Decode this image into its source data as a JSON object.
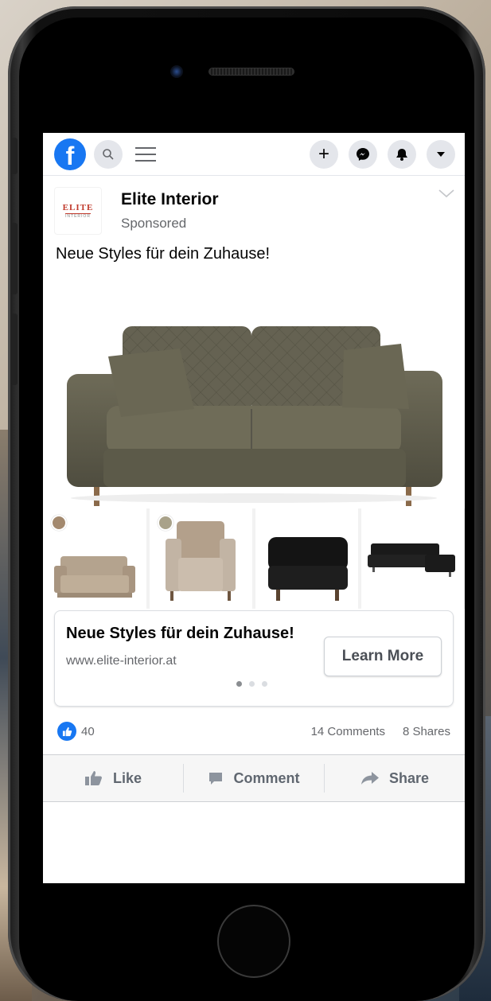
{
  "colors": {
    "facebook_blue": "#1877f2",
    "text_primary": "#050505",
    "text_secondary": "#65676b"
  },
  "topbar": {
    "logo_glyph": "f",
    "icons": [
      "search-icon",
      "menu-icon",
      "plus-icon",
      "messenger-icon",
      "notifications-icon",
      "dropdown-icon"
    ],
    "plus_glyph": "+"
  },
  "post": {
    "page_name": "Elite Interior",
    "avatar_brand": "ELITE",
    "avatar_sub": "INTERIOR",
    "sponsored_label": "Sponsored",
    "text": "Neue Styles für dein Zuhause!"
  },
  "carousel": {
    "products": [
      {
        "name": "sofa-beige",
        "swatch": "#a3896e"
      },
      {
        "name": "armchair-beige",
        "swatch": "#a9a28a"
      },
      {
        "name": "ottoman-black",
        "swatch": ""
      },
      {
        "name": "corner-sofa-black",
        "swatch": ""
      }
    ],
    "cta_title": "Neue Styles für dein Zuhause!",
    "cta_url": "www.elite-interior.at",
    "cta_button": "Learn More",
    "page_count": 3,
    "active_page": 1
  },
  "stats": {
    "likes": "40",
    "comments": "14 Comments",
    "shares": "8 Shares"
  },
  "actions": {
    "like": "Like",
    "comment": "Comment",
    "share": "Share"
  }
}
